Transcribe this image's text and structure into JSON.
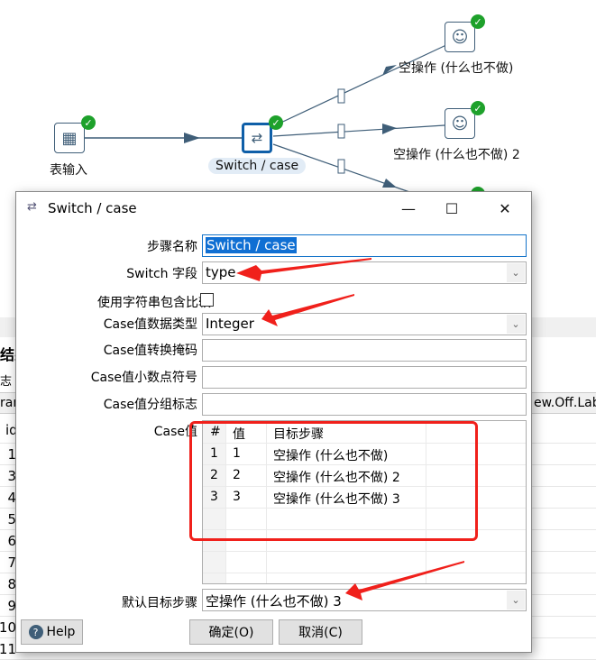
{
  "canvas": {
    "nodes": [
      {
        "id": "table-input",
        "label": "表输入",
        "status": "ok"
      },
      {
        "id": "switch-case",
        "label": "Switch / case",
        "status": "ok",
        "selected": true
      },
      {
        "id": "dummy-1",
        "label": "空操作 (什么也不做)",
        "status": "ok"
      },
      {
        "id": "dummy-2",
        "label": "空操作 (什么也不做) 2",
        "status": "ok"
      }
    ]
  },
  "background_panel": {
    "title_fragment": "结果",
    "tab_fragment": "志",
    "header_fragment_left": "ran",
    "header_fragment_right": "ew.Off.Labe",
    "column_header": "id",
    "row_ids": [
      "1",
      "3",
      "4",
      "5",
      "6",
      "7",
      "8",
      "9",
      "10",
      "11"
    ]
  },
  "dialog": {
    "title": "Switch / case",
    "title_icon": "switch-arrows-icon",
    "window_controls": {
      "minimize": "—",
      "maximize": "☐",
      "close": "✕"
    },
    "fields": {
      "step_name": {
        "label": "步骤名称",
        "value": "Switch / case"
      },
      "switch_field": {
        "label": "Switch 字段",
        "value": "type"
      },
      "use_contains": {
        "label": "使用字符串包含比较",
        "checked": false
      },
      "case_data_type": {
        "label": "Case值数据类型",
        "value": "Integer"
      },
      "case_conversion_mask": {
        "label": "Case值转换掩码",
        "value": ""
      },
      "case_decimal_symbol": {
        "label": "Case值小数点符号",
        "value": ""
      },
      "case_grouping_symbol": {
        "label": "Case值分组标志",
        "value": ""
      },
      "case_values_label": "Case值",
      "default_target": {
        "label": "默认目标步骤",
        "value": "空操作 (什么也不做) 3"
      }
    },
    "case_table": {
      "columns": [
        "#",
        "值",
        "目标步骤"
      ],
      "rows": [
        [
          "1",
          "1",
          "空操作 (什么也不做)"
        ],
        [
          "2",
          "2",
          "空操作 (什么也不做) 2"
        ],
        [
          "3",
          "3",
          "空操作 (什么也不做) 3"
        ]
      ]
    },
    "buttons": {
      "help": "Help",
      "ok": "确定(O)",
      "cancel": "取消(C)"
    }
  },
  "annotation_color": "#f0201b"
}
